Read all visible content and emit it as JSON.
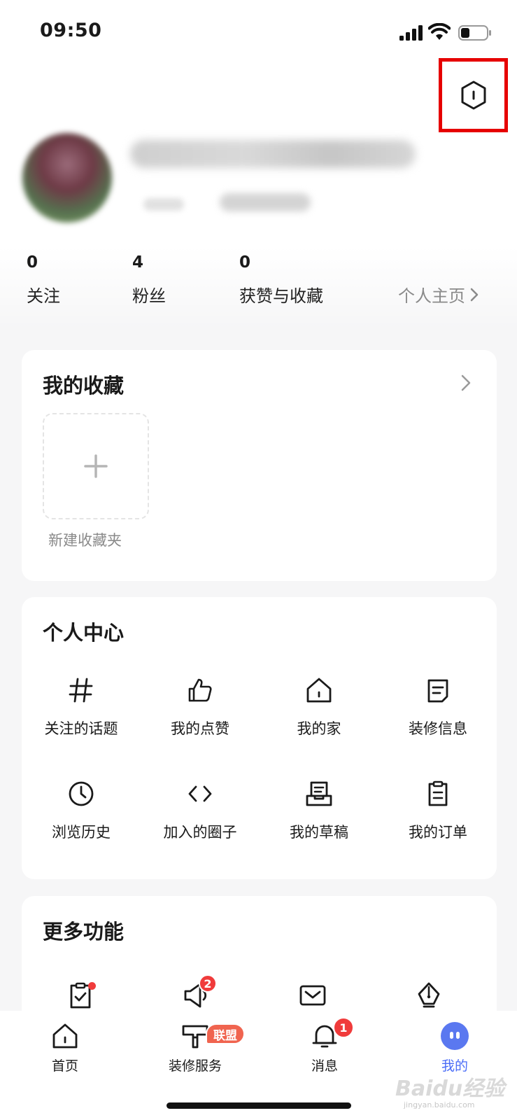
{
  "status_bar": {
    "time": "09:50"
  },
  "profile": {
    "stats": [
      {
        "value": "0",
        "label": "关注"
      },
      {
        "value": "4",
        "label": "粉丝"
      },
      {
        "value": "0",
        "label": "获赞与收藏"
      }
    ],
    "homepage_link": "个人主页"
  },
  "favorites": {
    "title": "我的收藏",
    "new_folder_label": "新建收藏夹"
  },
  "personal_center": {
    "title": "个人中心",
    "items": [
      {
        "label": "关注的话题",
        "icon": "hash-icon"
      },
      {
        "label": "我的点赞",
        "icon": "thumbs-up-icon"
      },
      {
        "label": "我的家",
        "icon": "house-icon"
      },
      {
        "label": "装修信息",
        "icon": "document-icon"
      },
      {
        "label": "浏览历史",
        "icon": "clock-icon"
      },
      {
        "label": "加入的圈子",
        "icon": "code-brackets-icon"
      },
      {
        "label": "我的草稿",
        "icon": "draft-tray-icon"
      },
      {
        "label": "我的订单",
        "icon": "clipboard-icon"
      }
    ]
  },
  "more_functions": {
    "title": "更多功能",
    "speaker_badge": "2"
  },
  "tabbar": {
    "tabs": [
      {
        "label": "首页"
      },
      {
        "label": "装修服务",
        "badge": "联盟"
      },
      {
        "label": "消息",
        "badge": "1"
      },
      {
        "label": "我的"
      }
    ],
    "active_color": "#4a6cf7"
  },
  "watermark": {
    "text": "Baidu经验",
    "sub": "jingyan.baidu.com"
  }
}
